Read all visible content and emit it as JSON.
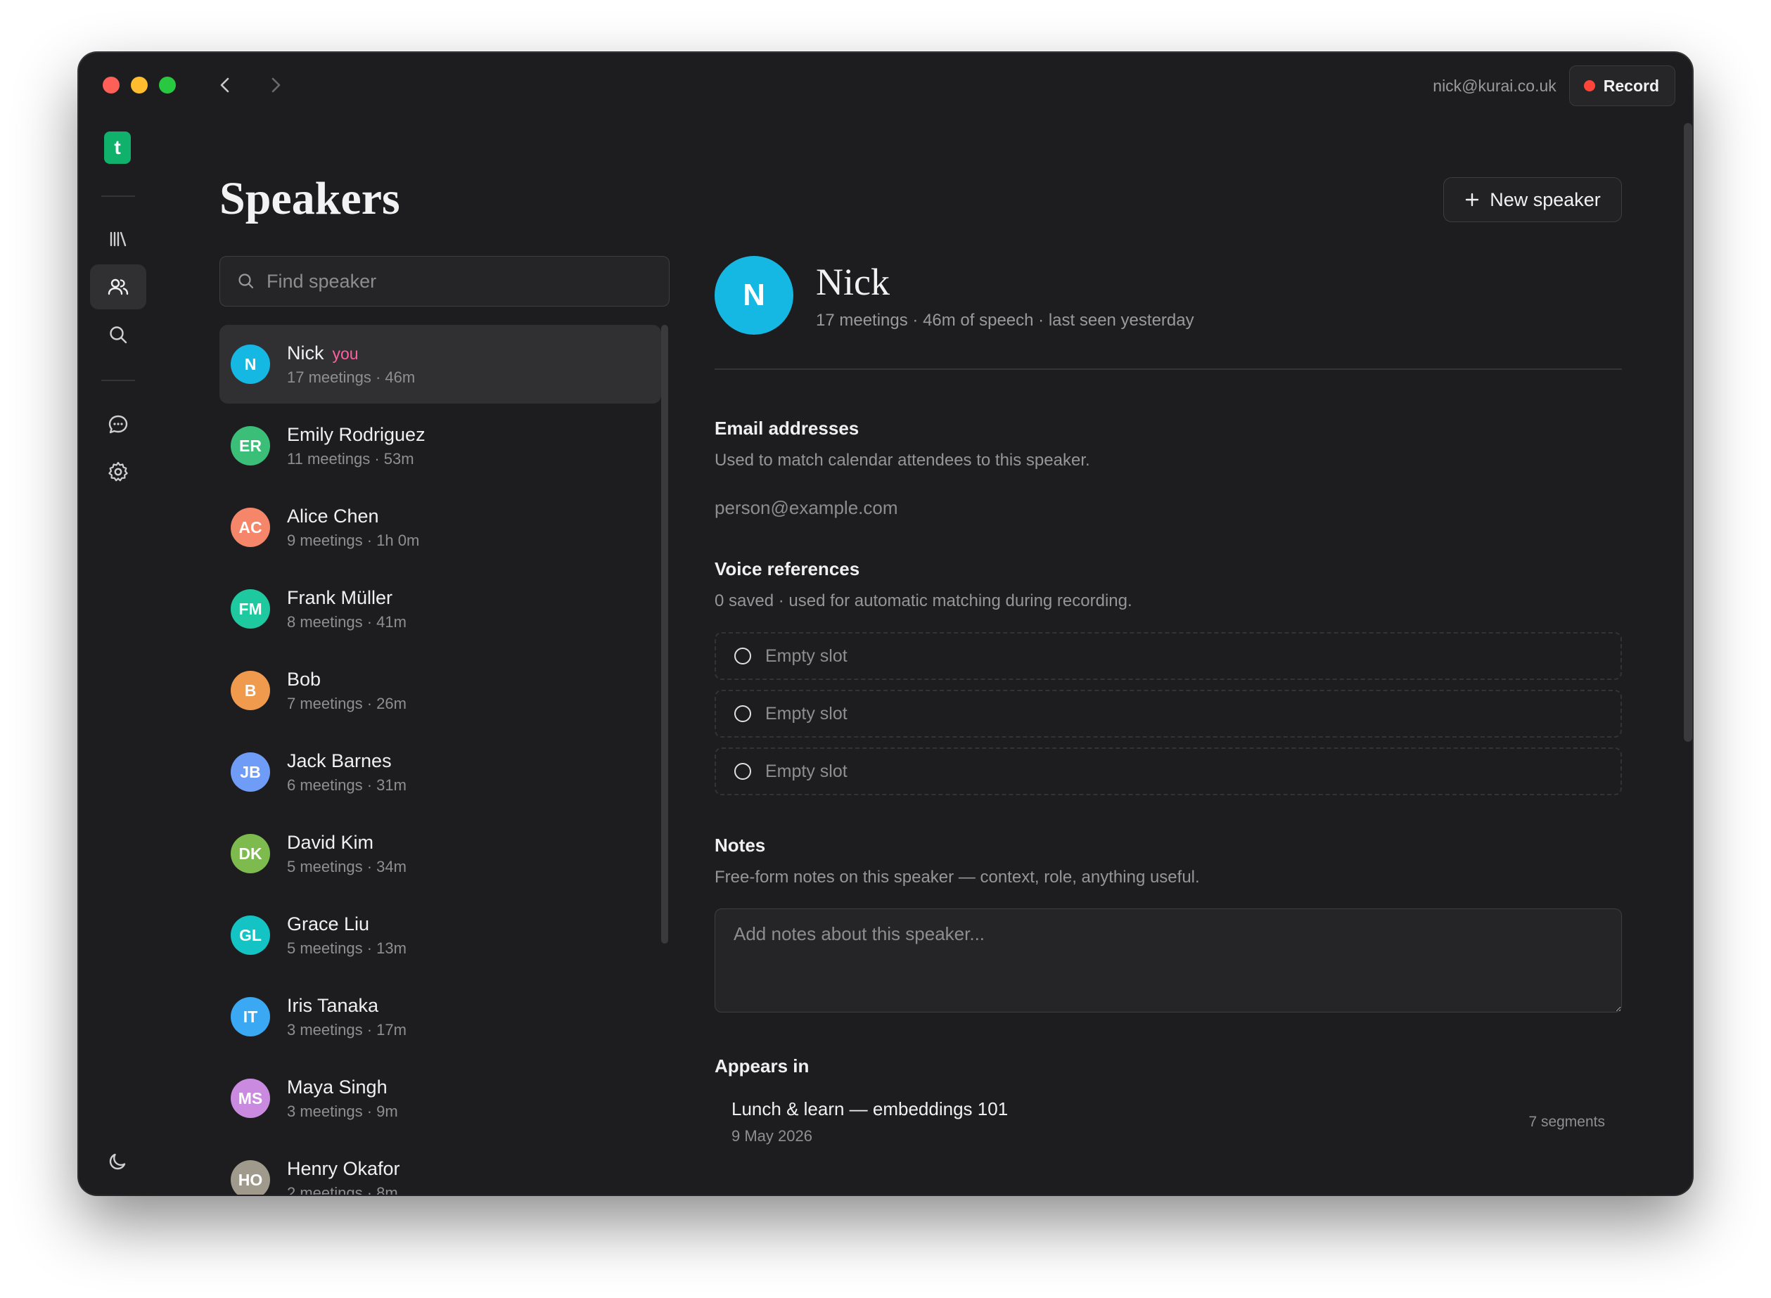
{
  "titlebar": {
    "account_email": "nick@kurai.co.uk",
    "record_label": "Record"
  },
  "rail": {
    "logo_letter": "t",
    "items": [
      {
        "icon": "library-icon"
      },
      {
        "icon": "speakers-icon",
        "active": true
      },
      {
        "icon": "search-icon"
      },
      {
        "icon": "chat-icon"
      },
      {
        "icon": "settings-icon"
      }
    ],
    "theme_icon": "moon-icon"
  },
  "page": {
    "title": "Speakers",
    "new_speaker_label": "New speaker"
  },
  "search": {
    "placeholder": "Find speaker"
  },
  "speakers": [
    {
      "initials": "N",
      "name": "Nick",
      "badge": "you",
      "meta": "17 meetings · 46m",
      "color": "#14b8e3",
      "selected": true
    },
    {
      "initials": "ER",
      "name": "Emily Rodriguez",
      "meta": "11 meetings · 53m",
      "color": "#3bbf78"
    },
    {
      "initials": "AC",
      "name": "Alice Chen",
      "meta": "9 meetings · 1h 0m",
      "color": "#f5866a"
    },
    {
      "initials": "FM",
      "name": "Frank Müller",
      "meta": "8 meetings · 41m",
      "color": "#1ec9a0"
    },
    {
      "initials": "B",
      "name": "Bob",
      "meta": "7 meetings · 26m",
      "color": "#f09a4e"
    },
    {
      "initials": "JB",
      "name": "Jack Barnes",
      "meta": "6 meetings · 31m",
      "color": "#6f9cf6"
    },
    {
      "initials": "DK",
      "name": "David Kim",
      "meta": "5 meetings · 34m",
      "color": "#7dbb4e"
    },
    {
      "initials": "GL",
      "name": "Grace Liu",
      "meta": "5 meetings · 13m",
      "color": "#14c3c3"
    },
    {
      "initials": "IT",
      "name": "Iris Tanaka",
      "meta": "3 meetings · 17m",
      "color": "#3aa8f2"
    },
    {
      "initials": "MS",
      "name": "Maya Singh",
      "meta": "3 meetings · 9m",
      "color": "#c98ae0"
    },
    {
      "initials": "HO",
      "name": "Henry Okafor",
      "meta": "2 meetings · 8m",
      "color": "#a09a8c"
    }
  ],
  "detail": {
    "initial": "N",
    "name": "Nick",
    "subtitle": "17 meetings · 46m of speech · last seen yesterday",
    "email": {
      "title": "Email addresses",
      "description": "Used to match calendar attendees to this speaker.",
      "placeholder": "person@example.com"
    },
    "voice": {
      "title": "Voice references",
      "description": "0 saved · used for automatic matching during recording.",
      "slots": [
        "Empty slot",
        "Empty slot",
        "Empty slot"
      ]
    },
    "notes": {
      "title": "Notes",
      "description": "Free-form notes on this speaker — context, role, anything useful.",
      "placeholder": "Add notes about this speaker..."
    },
    "appears": {
      "title": "Appears in",
      "items": [
        {
          "title": "Lunch & learn — embeddings 101",
          "date": "9 May 2026",
          "count": "7 segments"
        }
      ]
    }
  }
}
